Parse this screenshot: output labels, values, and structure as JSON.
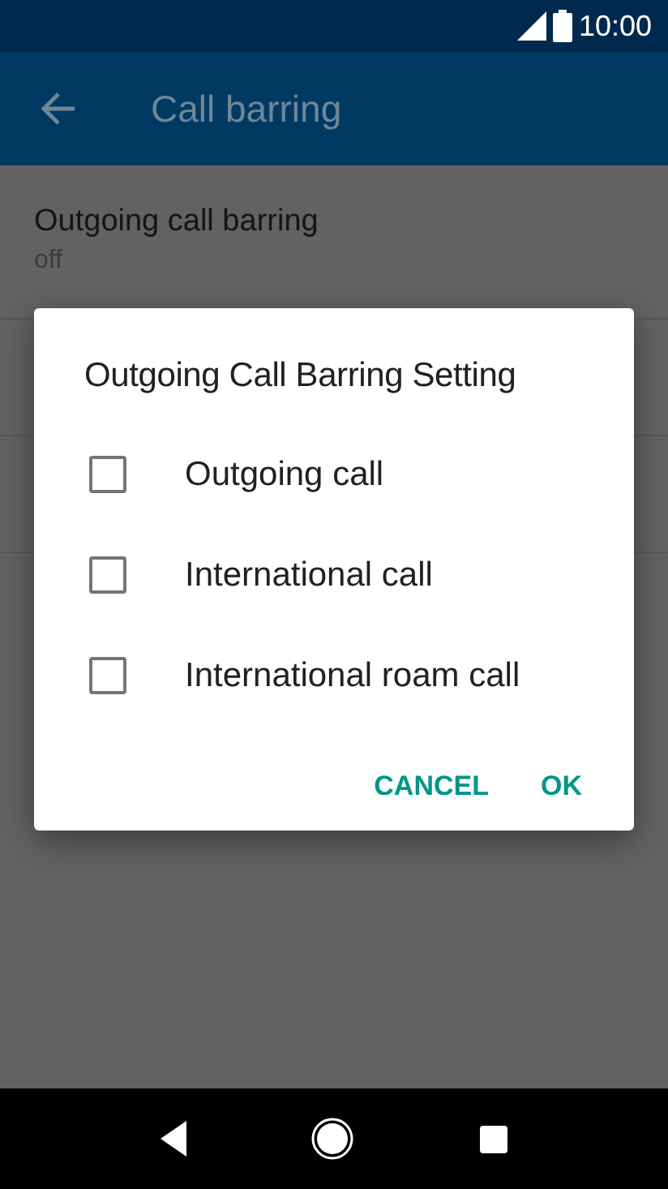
{
  "status_bar": {
    "time": "10:00"
  },
  "app_bar": {
    "title": "Call barring"
  },
  "settings": [
    {
      "title": "Outgoing call barring",
      "summary": "off"
    }
  ],
  "dialog": {
    "title": "Outgoing Call Barring Setting",
    "options": [
      {
        "label": "Outgoing call",
        "checked": false
      },
      {
        "label": "International call",
        "checked": false
      },
      {
        "label": "International roam call",
        "checked": false
      }
    ],
    "buttons": [
      "CANCEL",
      "OK"
    ]
  }
}
